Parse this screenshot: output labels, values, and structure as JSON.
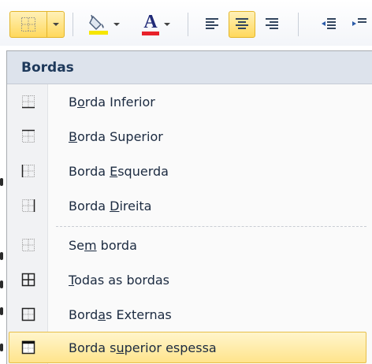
{
  "toolbar": {
    "borders_button": {
      "icon": "borders-icon"
    },
    "fill_button": {
      "icon": "paint-bucket-icon",
      "color": "#f6e600"
    },
    "font_color_button": {
      "letter": "A",
      "color": "#e8212a"
    },
    "align_left": {
      "icon": "align-left-icon"
    },
    "align_center": {
      "icon": "align-center-icon",
      "active": true
    },
    "align_right": {
      "icon": "align-right-icon"
    },
    "decrease_indent": {
      "icon": "decrease-indent-icon"
    }
  },
  "menu": {
    "header": "Bordas",
    "items": [
      {
        "pre": "B",
        "key": "o",
        "post": "rda Inferior",
        "icon": "border-bottom-icon"
      },
      {
        "pre": "",
        "key": "B",
        "post": "orda Superior",
        "icon": "border-top-icon"
      },
      {
        "pre": "Borda ",
        "key": "E",
        "post": "squerda",
        "icon": "border-left-icon"
      },
      {
        "pre": "Borda ",
        "key": "D",
        "post": "ireita",
        "icon": "border-right-icon"
      },
      {
        "pre": "Se",
        "key": "m",
        "post": " borda",
        "icon": "no-border-icon"
      },
      {
        "pre": "",
        "key": "T",
        "post": "odas as bordas",
        "icon": "all-borders-icon"
      },
      {
        "pre": "Bord",
        "key": "a",
        "post": "s Externas",
        "icon": "outside-borders-icon"
      },
      {
        "pre": "Borda s",
        "key": "u",
        "post": "perior espessa",
        "icon": "thick-top-border-icon",
        "hover": true
      }
    ]
  },
  "colors": {
    "accent": "#ffd85c",
    "header_bg": "#dde3ec",
    "header_text": "#1e395b"
  }
}
